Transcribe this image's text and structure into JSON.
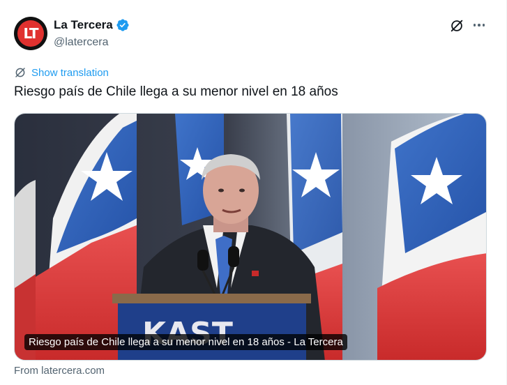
{
  "author": {
    "display_name": "La Tercera",
    "handle": "@latercera",
    "avatar_text": "LT",
    "verified": true,
    "brand_color": "#e0312f"
  },
  "actions": {
    "grok_icon": "grok-icon",
    "more_icon": "more-horizontal-icon"
  },
  "translation": {
    "label": "Show translation",
    "icon": "translate-icon"
  },
  "tweet": {
    "text": "Riesgo país de Chile llega a su menor nivel en 18 años"
  },
  "link_card": {
    "caption": "Riesgo país de Chile llega a su menor nivel en 18 años - La Tercera",
    "source": "From latercera.com",
    "podium_text": "KAST"
  },
  "colors": {
    "accent": "#1d9bf0",
    "text_primary": "#0f1419",
    "text_secondary": "#536471",
    "verified": "#1d9bf0"
  }
}
